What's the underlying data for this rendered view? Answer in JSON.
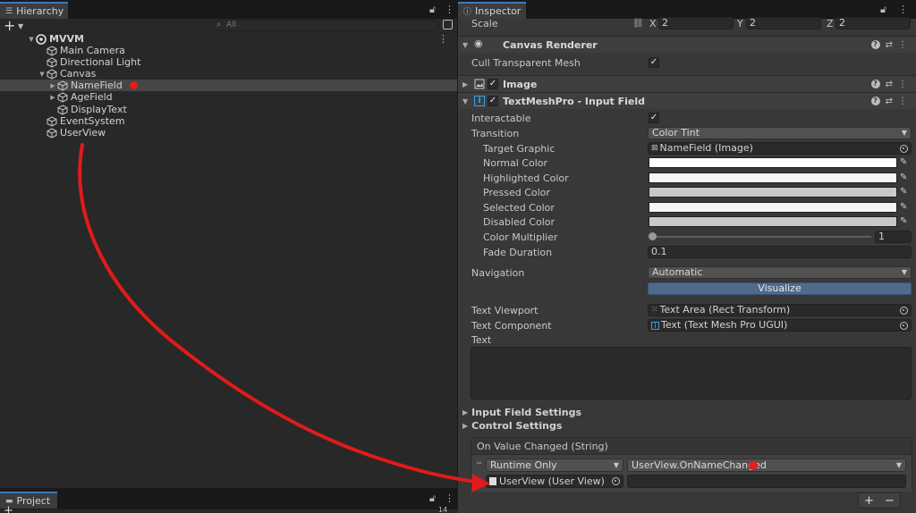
{
  "hierarchy": {
    "tab_label": "Hierarchy",
    "search_placeholder": "All",
    "scene_name": "MVVM",
    "items": [
      {
        "label": "Main Camera"
      },
      {
        "label": "Directional Light"
      },
      {
        "label": "Canvas"
      },
      {
        "label": "NameField"
      },
      {
        "label": "AgeField"
      },
      {
        "label": "DisplayText"
      },
      {
        "label": "EventSystem"
      },
      {
        "label": "UserView"
      }
    ]
  },
  "project": {
    "tab_label": "Project",
    "count_label": "14"
  },
  "inspector": {
    "tab_label": "Inspector",
    "scale": {
      "label": "Scale",
      "x_label": "X",
      "x": "2",
      "y_label": "Y",
      "y": "2",
      "z_label": "Z",
      "z": "2"
    },
    "canvas_renderer": {
      "title": "Canvas Renderer",
      "cull_label": "Cull Transparent Mesh"
    },
    "image": {
      "title": "Image"
    },
    "input_field": {
      "title": "TextMeshPro - Input Field",
      "interactable_label": "Interactable",
      "transition_label": "Transition",
      "transition_value": "Color Tint",
      "target_graphic_label": "Target Graphic",
      "target_graphic_value": "NameField (Image)",
      "normal_color_label": "Normal Color",
      "highlighted_color_label": "Highlighted Color",
      "pressed_color_label": "Pressed Color",
      "selected_color_label": "Selected Color",
      "disabled_color_label": "Disabled Color",
      "color_multiplier_label": "Color Multiplier",
      "color_multiplier_value": "1",
      "fade_duration_label": "Fade Duration",
      "fade_duration_value": "0.1",
      "navigation_label": "Navigation",
      "navigation_value": "Automatic",
      "visualize_label": "Visualize",
      "text_viewport_label": "Text Viewport",
      "text_viewport_value": "Text Area (Rect Transform)",
      "text_component_label": "Text Component",
      "text_component_value": "Text (Text Mesh Pro UGUI)",
      "text_label": "Text",
      "input_field_settings_label": "Input Field Settings",
      "control_settings_label": "Control Settings",
      "event_header": "On Value Changed (String)",
      "runtime_value": "Runtime Only",
      "function_value": "UserView.OnNameChanged",
      "object_value": "UserView (User View)"
    },
    "colors": {
      "normal": "#ffffff",
      "highlighted": "#f5f5f5",
      "pressed": "#c8c8c8",
      "selected": "#f5f5f5",
      "disabled": "#c8c8c8"
    }
  },
  "annotation": {
    "arrow_color": "#e01b1b"
  }
}
